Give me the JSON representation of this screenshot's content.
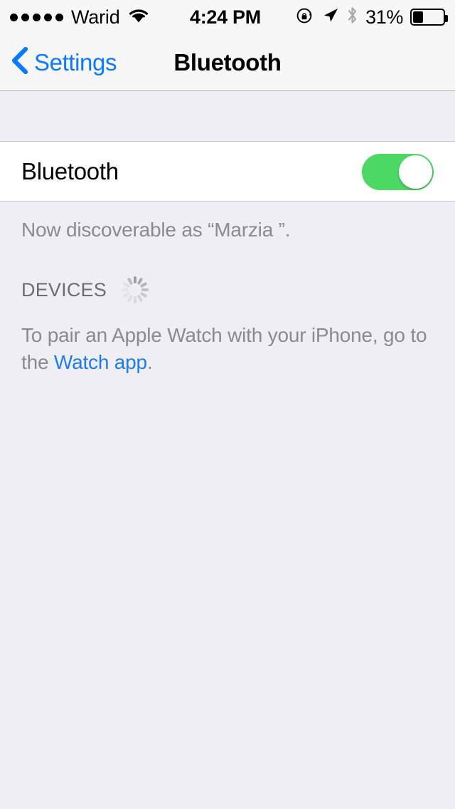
{
  "status_bar": {
    "signal_dots_filled": 5,
    "signal_dots_total": 5,
    "carrier": "Warid",
    "wifi_icon": "wifi-icon",
    "time": "4:24 PM",
    "rotation_lock_icon": "rotation-lock-icon",
    "location_icon": "location-arrow-icon",
    "bluetooth_icon": "bluetooth-icon",
    "battery_percent_label": "31%",
    "battery_level": 31,
    "colors": {
      "text": "#000000",
      "bluetooth_icon": "#A8A8A8",
      "background": "#F7F7F7"
    }
  },
  "nav_bar": {
    "back_icon": "chevron-left-icon",
    "back_label": "Settings",
    "title": "Bluetooth",
    "tint_color": "#0A7AFF"
  },
  "main": {
    "bluetooth_row": {
      "label": "Bluetooth",
      "toggle_state": "on",
      "toggle_on_color": "#4BD863"
    },
    "discoverable_note": "Now discoverable as “Marzia ”.",
    "devices_section": {
      "header": "DEVICES",
      "spinner": "activity-indicator-icon",
      "searching": true
    },
    "pair_note": {
      "prefix": "To pair an Apple Watch with your iPhone, go to the ",
      "link_text": "Watch app",
      "suffix": "."
    }
  },
  "theme": {
    "group_background": "#EFEEF4",
    "cell_background": "#FFFFFF",
    "separator": "#C8C7CC",
    "secondary_text": "#8A8A8F",
    "header_text": "#6D6D72",
    "link": "#1D7CF2"
  }
}
